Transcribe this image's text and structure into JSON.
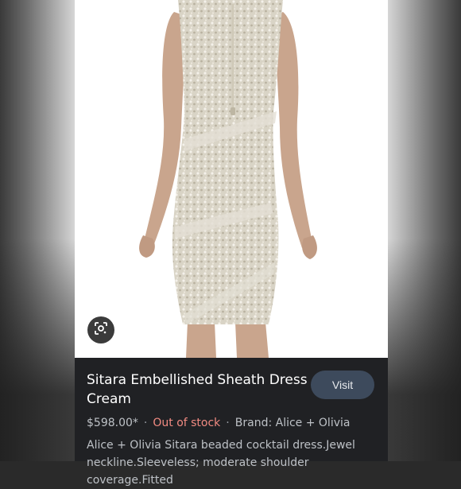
{
  "product": {
    "title": "Sitara Embellished Sheath Dress Cream",
    "price": "$598.00*",
    "stock_status": "Out of stock",
    "brand": "Brand: Alice + Olivia",
    "description_line1": "Alice + Olivia Sitara beaded cocktail dress.Jewel",
    "description_line2": "neckline.Sleeveless; moderate shoulder coverage.Fitted",
    "separator": "·"
  },
  "actions": {
    "visit_label": "Visit"
  },
  "icons": {
    "lens": "google-lens-icon"
  },
  "colors": {
    "panel_bg": "#202124",
    "visit_bg": "#3d4a5c",
    "stock_red": "#f28b82",
    "dress": "#dcd7c9"
  }
}
